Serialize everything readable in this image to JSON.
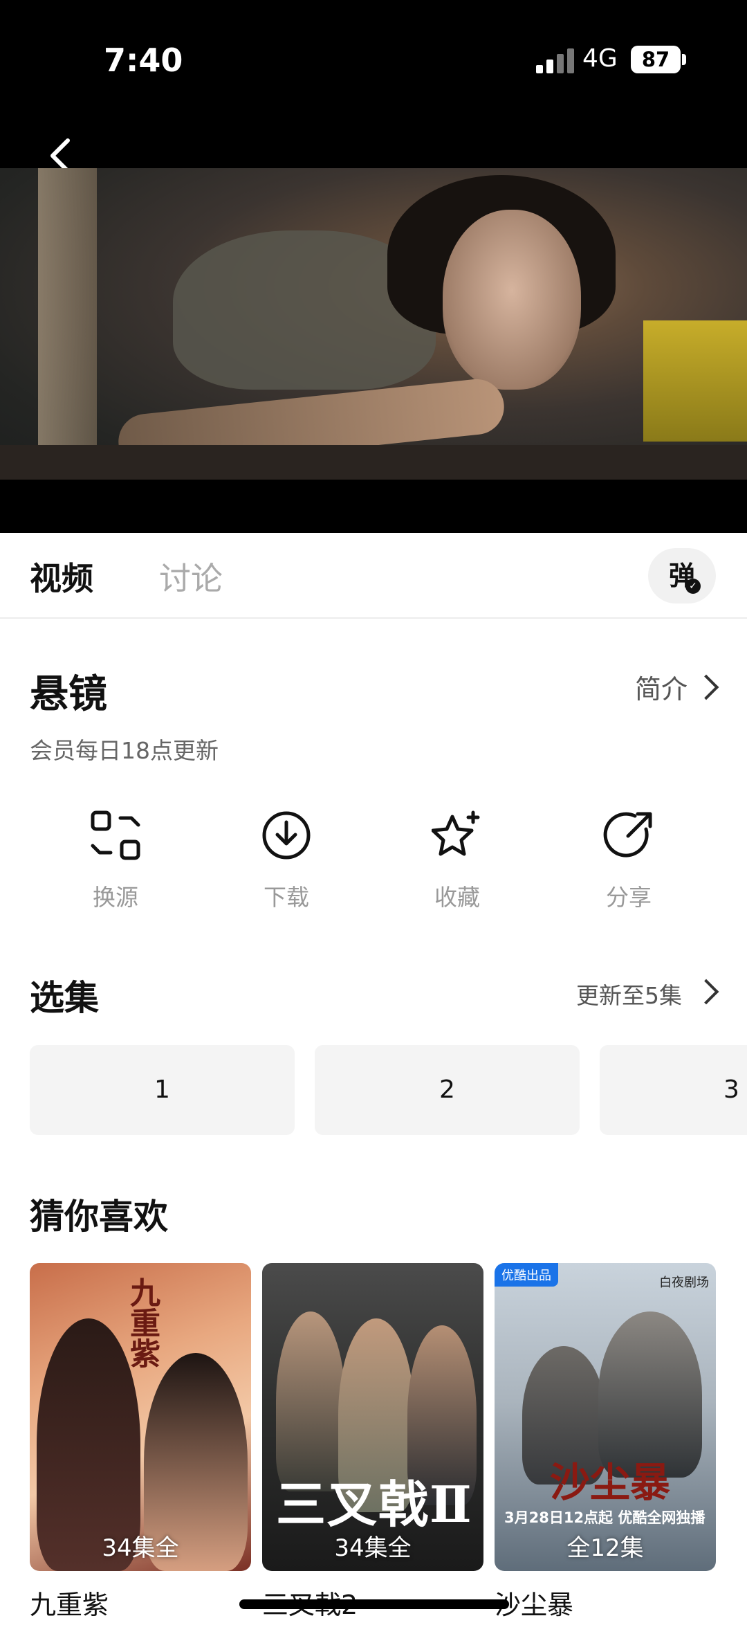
{
  "status_bar": {
    "time": "7:40",
    "network": "4G",
    "battery": "87"
  },
  "tabs": {
    "video": "视频",
    "discuss": "讨论",
    "danmu": "弹"
  },
  "show": {
    "title": "悬镜",
    "intro_label": "简介",
    "subtitle": "会员每日18点更新"
  },
  "actions": [
    {
      "label": "换源",
      "icon": "switch-source-icon"
    },
    {
      "label": "下载",
      "icon": "download-icon"
    },
    {
      "label": "收藏",
      "icon": "favorite-star-icon"
    },
    {
      "label": "分享",
      "icon": "share-icon"
    }
  ],
  "episodes": {
    "title": "选集",
    "update_label": "更新至5集",
    "items": [
      "1",
      "2",
      "3"
    ]
  },
  "recommend": {
    "title": "猜你喜欢",
    "items": [
      {
        "name": "九重紫",
        "badge": "34集全",
        "poster_title": "九重紫"
      },
      {
        "name": "三叉戟2",
        "badge": "34集全",
        "poster_title": "三叉戟Ⅱ"
      },
      {
        "name": "沙尘暴",
        "badge": "全12集",
        "poster_title": "沙尘暴",
        "tag": "优酷出品",
        "corner": "白夜剧场",
        "promo": "3月28日12点起 优酷全网独播"
      }
    ]
  }
}
